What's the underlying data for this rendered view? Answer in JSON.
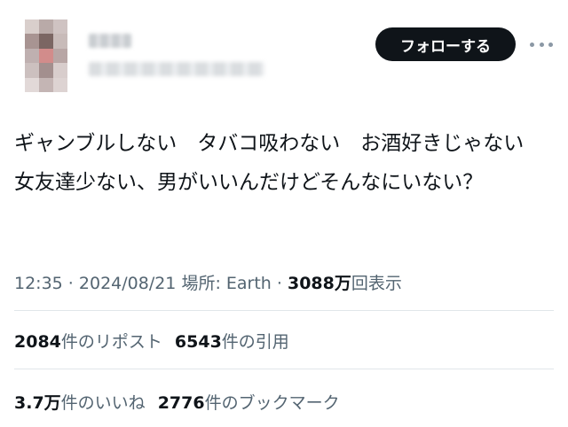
{
  "header": {
    "follow_label": "フォローする",
    "more_icon": "more-horizontal-icon"
  },
  "tweet": {
    "text": "ギャンブルしない　タバコ吸わない　お酒好きじゃない　女友達少ない、男がいいんだけどそんなにいない？"
  },
  "meta": {
    "time": "12:35",
    "sep1": " · ",
    "date": "2024/08/21",
    "location": " 場所: Earth",
    "sep2": " · ",
    "views_number": "3088万",
    "views_label": "回表示"
  },
  "stats": {
    "reposts": {
      "number": "2084",
      "label": "件のリポスト"
    },
    "quotes": {
      "number": "6543",
      "label": "件の引用"
    },
    "likes": {
      "number": "3.7万",
      "label": "件のいいね"
    },
    "bookmarks": {
      "number": "2776",
      "label": "件のブックマーク"
    }
  }
}
